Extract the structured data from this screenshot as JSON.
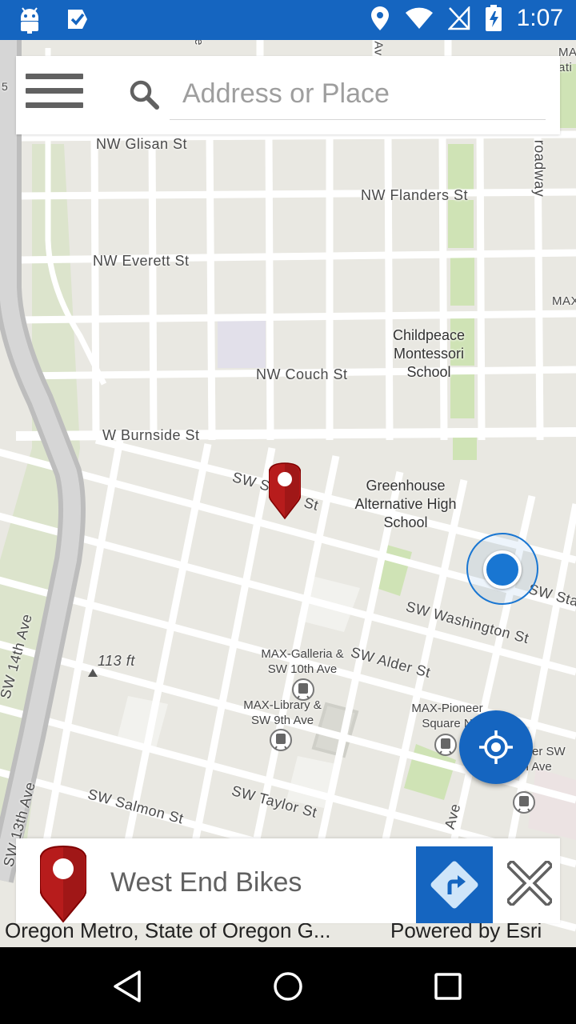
{
  "status_bar": {
    "time": "1:07",
    "left_icons": [
      "android-icon",
      "task-check-icon"
    ],
    "right_icons": [
      "location-icon",
      "wifi-icon",
      "no-sim-icon",
      "battery-charging-icon"
    ]
  },
  "search": {
    "placeholder": "Address or Place",
    "value": ""
  },
  "map": {
    "street_labels": [
      "NW Glisan St",
      "NW Flanders St",
      "NW Everett St",
      "NW Couch St",
      "W Burnside St",
      "SW S",
      "St",
      "SW Washington St",
      "SW Alder St",
      "SW Salmon St",
      "SW Taylor St",
      "SW 14th Ave",
      "SW 13th Ave",
      "roadway",
      "SW Sta",
      "Ave"
    ],
    "poi_labels": [
      "Childpeace Montessori School",
      "Greenhouse Alternative High School"
    ],
    "transit_labels": [
      "MAX-Galleria & SW 10th Ave",
      "MAX-Library & SW 9th Ave",
      "MAX-Pioneer Square N",
      "oneer SW 5th Ave"
    ],
    "edge_labels": [
      "MA",
      "ati",
      "MAX",
      "5",
      "e",
      "Av"
    ],
    "elevation": "113 ft"
  },
  "place_card": {
    "name": "West End Bikes"
  },
  "attribution": {
    "left": "Oregon Metro, State of Oregon G...",
    "right": "Powered by Esri"
  },
  "colors": {
    "primary": "#1565c0",
    "pin_red": "#b71c1c",
    "map_bg": "#e9e8e2",
    "park_green": "#c9dfb1"
  }
}
